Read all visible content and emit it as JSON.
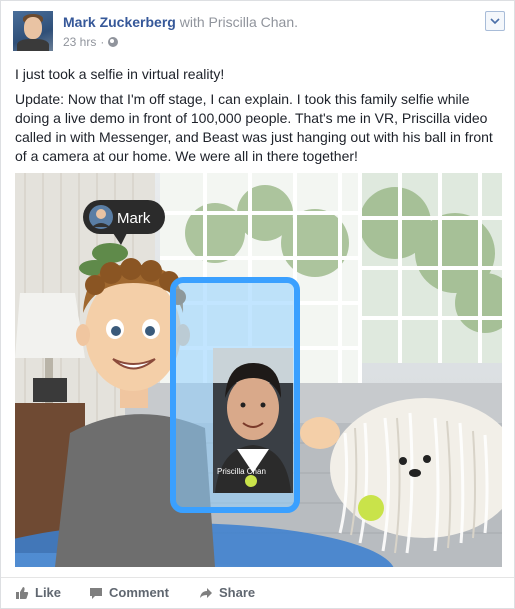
{
  "post": {
    "author": "Mark Zuckerberg",
    "with_text": "with",
    "tagged": "Priscilla Chan.",
    "time": "23 hrs",
    "separator": "·",
    "audience_icon": "globe-icon",
    "paragraphs": [
      "I just took a selfie in virtual reality!",
      "Update: Now that I'm off stage, I can explain. I took this family selfie while doing a live demo in front of 100,000 people. That's me in VR, Priscilla video called in with Messenger, and Beast was just hanging out with his ball in front of a camera at our home. We were all in there together!"
    ]
  },
  "photo": {
    "name_tag": "Mark",
    "video_caption": "Priscilla Chan"
  },
  "actions": {
    "like": "Like",
    "comment": "Comment",
    "share": "Share"
  },
  "colors": {
    "link": "#365899",
    "muted": "#90949c",
    "text": "#1d2129",
    "action": "#606770",
    "frame_blue": "#3aa0ff"
  }
}
